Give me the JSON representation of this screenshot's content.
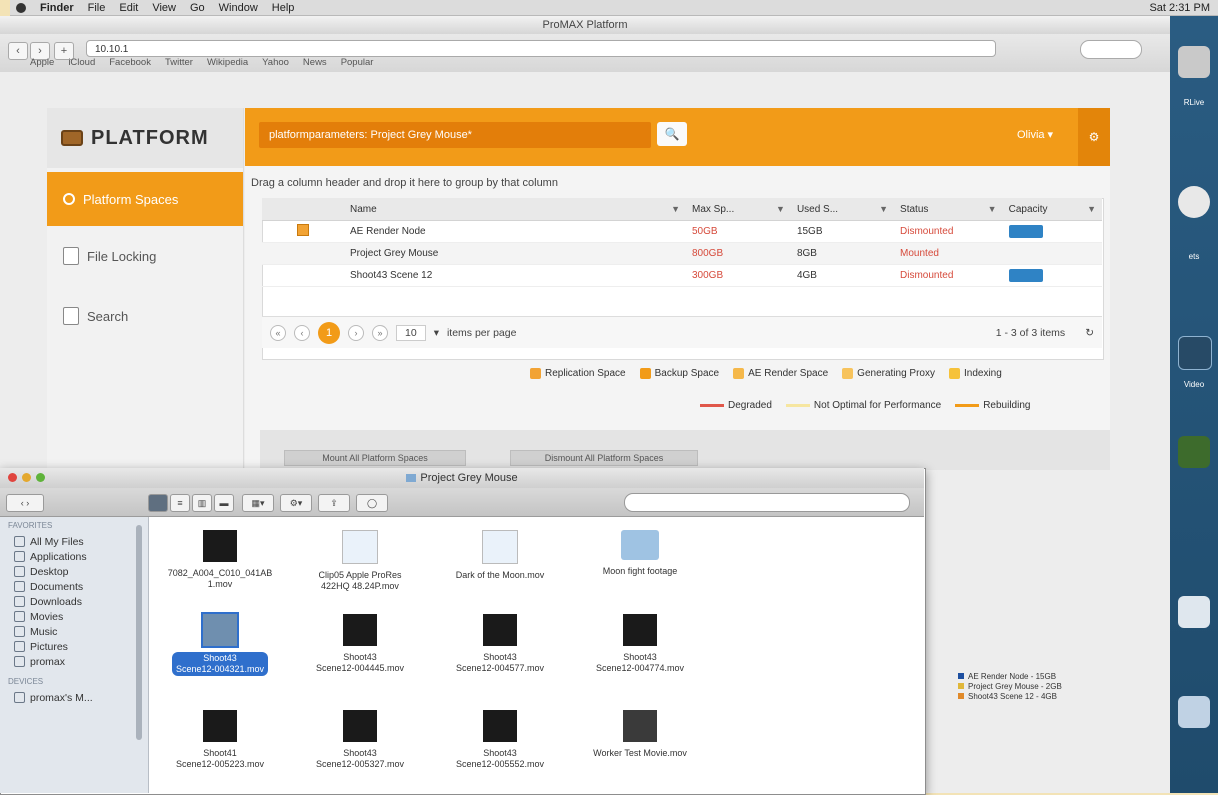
{
  "menubar": {
    "items": [
      "Finder",
      "File",
      "Edit",
      "View",
      "Go",
      "Window",
      "Help"
    ],
    "clock": "Sat 2:31 PM"
  },
  "browser": {
    "window_title": "ProMAX Platform",
    "address": "10.10.1",
    "bookmarks": [
      "Apple",
      "iCloud",
      "Facebook",
      "Twitter",
      "Wikipedia",
      "Yahoo",
      "News",
      "Popular"
    ]
  },
  "app": {
    "logo_text": "PLATFORM",
    "nav": [
      {
        "label": "Platform Spaces",
        "icon": "platform-icon"
      },
      {
        "label": "File Locking",
        "icon": "file-icon"
      },
      {
        "label": "Search",
        "icon": "search-icon"
      }
    ],
    "search_value": "platformparameters: Project Grey Mouse*",
    "user_menu": "Olivia ▾",
    "drag_hint": "Drag a column header and drop it here to group by that column",
    "columns": [
      "Name",
      "Max Sp...",
      "Used S...",
      "Status",
      "Capacity"
    ],
    "rows": [
      {
        "name": "AE Render Node",
        "max": "50GB",
        "used": "15GB",
        "status": "Dismounted",
        "capacity": true,
        "flag": true
      },
      {
        "name": "Project Grey Mouse",
        "max": "800GB",
        "used": "8GB",
        "status": "Mounted",
        "capacity": false,
        "flag": false
      },
      {
        "name": "Shoot43 Scene 12",
        "max": "300GB",
        "used": "4GB",
        "status": "Dismounted",
        "capacity": true,
        "flag": false
      }
    ],
    "pager": {
      "current": "1",
      "page_size": "10",
      "items_label": "items per page",
      "info": "1 - 3 of 3 items"
    },
    "legend_row1": [
      {
        "label": "Replication Space",
        "color": "#f2a334"
      },
      {
        "label": "Backup Space",
        "color": "#f29b18"
      },
      {
        "label": "AE Render Space",
        "color": "#f5b84a"
      },
      {
        "label": "Generating Proxy",
        "color": "#f7c35c"
      },
      {
        "label": "Indexing",
        "color": "#f6c23a"
      }
    ],
    "legend_row2": [
      {
        "label": "Degraded",
        "color": "#e0574a"
      },
      {
        "label": "Not Optimal for Performance",
        "color": "#f6e6a0"
      },
      {
        "label": "Rebuilding",
        "color": "#f29b18"
      }
    ],
    "actions": [
      "Mount All Platform Spaces",
      "Dismount All Platform Spaces"
    ]
  },
  "finder": {
    "title": "Project Grey Mouse",
    "sidebar_header_favorites": "FAVORITES",
    "sidebar_favorites": [
      "All My Files",
      "Applications",
      "Desktop",
      "Documents",
      "Downloads",
      "Movies",
      "Music",
      "Pictures",
      "promax"
    ],
    "sidebar_header_devices": "DEVICES",
    "sidebar_devices": [
      "promax's M..."
    ],
    "files": [
      {
        "name": "7082_A004_C010_041AB\n1.mov",
        "kind": "video"
      },
      {
        "name": "Clip05 Apple ProRes\n422HQ 48.24P.mov",
        "kind": "qt"
      },
      {
        "name": "Dark of the Moon.mov",
        "kind": "qt"
      },
      {
        "name": "Moon fight footage",
        "kind": "folder"
      },
      {
        "name": "Shoot43\nScene12-004321.mov",
        "kind": "sel"
      },
      {
        "name": "Shoot43\nScene12-004445.mov",
        "kind": "video"
      },
      {
        "name": "Shoot43\nScene12-004577.mov",
        "kind": "video"
      },
      {
        "name": "Shoot43\nScene12-004774.mov",
        "kind": "video"
      },
      {
        "name": "Shoot41\nScene12-005223.mov",
        "kind": "video"
      },
      {
        "name": "Shoot43\nScene12-005327.mov",
        "kind": "video"
      },
      {
        "name": "Shoot43\nScene12-005552.mov",
        "kind": "video"
      },
      {
        "name": "Worker Test Movie.mov",
        "kind": "video"
      }
    ]
  },
  "chart_legend": [
    {
      "label": "AE Render Node - 15GB",
      "color": "#1d4fa0"
    },
    {
      "label": "Project Grey Mouse - 2GB",
      "color": "#e0b73a"
    },
    {
      "label": "Shoot43 Scene 12 - 4GB",
      "color": "#e08a2a"
    }
  ],
  "dock_labels": [
    "RLive",
    "",
    "ets",
    "Video",
    ""
  ]
}
